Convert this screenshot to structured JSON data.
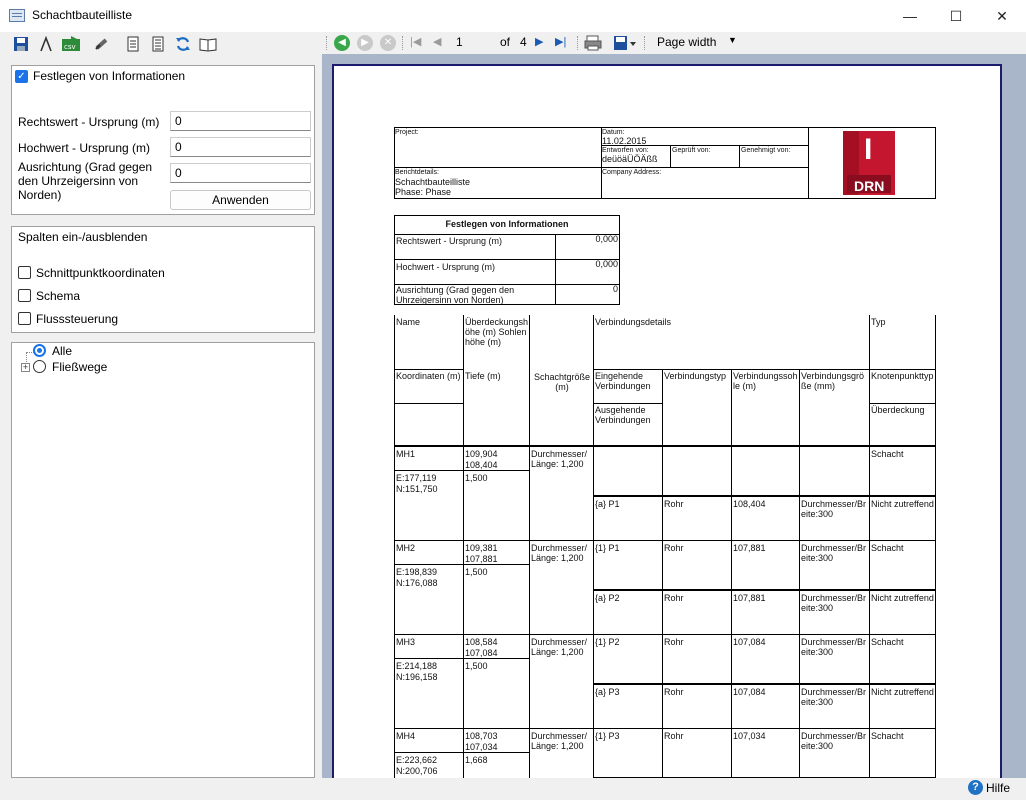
{
  "window": {
    "title": "Schachtbauteilliste",
    "minimize": "—",
    "maximize": "☐",
    "close": "✕"
  },
  "settings": {
    "checkbox_label": "Festlegen von Informationen",
    "fields": [
      {
        "label": "Rechtswert - Ursprung (m)",
        "value": "0"
      },
      {
        "label": "Hochwert - Ursprung (m)",
        "value": "0"
      },
      {
        "label": "Ausrichtung (Grad gegen den Uhrzeigersinn von Norden)",
        "value": "0"
      }
    ],
    "apply_label": "Anwenden"
  },
  "columns": {
    "title": "Spalten ein-/ausblenden",
    "items": [
      "Schnittpunktkoordinaten",
      "Schema",
      "Flusssteuerung"
    ]
  },
  "tree": {
    "items": [
      "Alle",
      "Fließwege"
    ]
  },
  "viewer": {
    "page": "1",
    "of_label": "of",
    "total_pages": "4",
    "zoom": "Page width"
  },
  "report": {
    "header": {
      "project_label": "Project:",
      "datum_label": "Datum:",
      "datum": "11.02.2015",
      "entworfen_label": "Entworfen von:",
      "entworfen": "deüöäÜÖÄßß",
      "geprueft_label": "Geprüft von:",
      "genehmigt_label": "Genehmigt von:",
      "details_label": "Berichtdetails:",
      "details_1": "Schachtbauteilliste",
      "details_2": "Phase: Phase",
      "company_label": "Company Address:",
      "logo_letter": "I",
      "logo_text": "DRN"
    },
    "info": {
      "title": "Festlegen von Informationen",
      "rows": [
        {
          "label": "Rechtswert - Ursprung (m)",
          "value": "0,000"
        },
        {
          "label": "Hochwert - Ursprung (m)",
          "value": "0,000"
        },
        {
          "label": "Ausrichtung (Grad gegen den Uhrzeigersinn von Norden)",
          "value": "0"
        }
      ]
    },
    "table": {
      "h_name": "Name",
      "h_cover": "Überdeckungshöhe (m) Sohlenhöhe (m)",
      "h_conn": "Verbindungsdetails",
      "h_type": "Typ",
      "h_coord": "Koordinaten (m)",
      "h_depth": "Tiefe (m)",
      "h_size": "Schachtgröße (m)",
      "h_in": "Eingehende Verbindungen",
      "h_ctype": "Verbindungstyp",
      "h_invert": "Verbindungssohle (m)",
      "h_csize": "Verbindungsgröße (mm)",
      "h_ntype": "Knotenpunkttyp",
      "h_out": "Ausgehende Verbindungen",
      "h_cover2": "Überdeckung",
      "rows": [
        {
          "name": "MH1",
          "rim": "109,904",
          "inv": "108,404",
          "e": "E:177,119",
          "n": "N:151,750",
          "depth": "1,500",
          "size": "Durchmesser/ Länge: 1,200",
          "type": "Schacht",
          "conns": [
            {
              "pipe": "",
              "ctype": "",
              "invert": "",
              "csize": "",
              "ntype": "Schacht"
            },
            {
              "pipe": "{a} P1",
              "ctype": "Rohr",
              "invert": "108,404",
              "csize": "Durchmesser/Breite:300",
              "ntype": "Nicht zutreffend"
            }
          ]
        },
        {
          "name": "MH2",
          "rim": "109,381",
          "inv": "107,881",
          "e": "E:198,839",
          "n": "N:176,088",
          "depth": "1,500",
          "size": "Durchmesser/ Länge: 1,200",
          "type": "Schacht",
          "conns": [
            {
              "pipe": "{1} P1",
              "ctype": "Rohr",
              "invert": "107,881",
              "csize": "Durchmesser/Breite:300",
              "ntype": "Schacht"
            },
            {
              "pipe": "{a} P2",
              "ctype": "Rohr",
              "invert": "107,881",
              "csize": "Durchmesser/Breite:300",
              "ntype": "Nicht zutreffend"
            }
          ]
        },
        {
          "name": "MH3",
          "rim": "108,584",
          "inv": "107,084",
          "e": "E:214,188",
          "n": "N:196,158",
          "depth": "1,500",
          "size": "Durchmesser/ Länge: 1,200",
          "type": "Schacht",
          "conns": [
            {
              "pipe": "{1} P2",
              "ctype": "Rohr",
              "invert": "107,084",
              "csize": "Durchmesser/Breite:300",
              "ntype": "Schacht"
            },
            {
              "pipe": "{a} P3",
              "ctype": "Rohr",
              "invert": "107,084",
              "csize": "Durchmesser/Breite:300",
              "ntype": "Nicht zutreffend"
            }
          ]
        },
        {
          "name": "MH4",
          "rim": "108,703",
          "inv": "107,034",
          "e": "E:223,662",
          "n": "N:200,706",
          "depth": "1,668",
          "size": "Durchmesser/ Länge: 1,200",
          "type": "Schacht",
          "conns": [
            {
              "pipe": "{1} P3",
              "ctype": "Rohr",
              "invert": "107,034",
              "csize": "Durchmesser/Breite:300",
              "ntype": "Schacht"
            }
          ]
        }
      ]
    }
  },
  "status": {
    "help": "Hilfe"
  }
}
